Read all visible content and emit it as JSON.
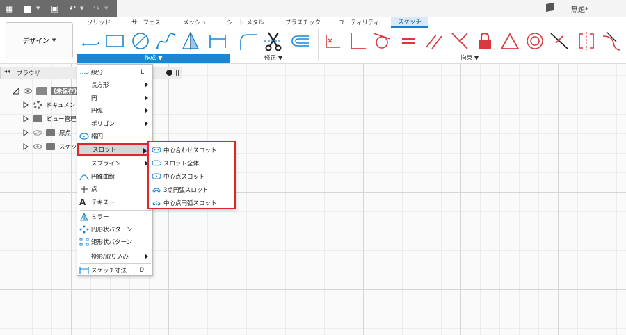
{
  "window": {
    "title": "無題*"
  },
  "tabs": [
    "ソリッド",
    "サーフェス",
    "メッシュ",
    "シート メタル",
    "プラスチック",
    "ユーティリティ",
    "スケッチ"
  ],
  "workspace": {
    "label": "デザイン"
  },
  "groups": {
    "create": "作成",
    "modify": "修正",
    "constraints": "拘束"
  },
  "browser": {
    "title": "ブラウザ",
    "root": "(未保存)",
    "items": [
      "ドキュメント",
      "ビュー管理",
      "原点",
      "スケッチ"
    ]
  },
  "create_menu": {
    "items": [
      {
        "label": "線分",
        "key": "L",
        "icon": "line-icon"
      },
      {
        "label": "長方形",
        "submenu": true
      },
      {
        "label": "円",
        "submenu": true
      },
      {
        "label": "円弧",
        "submenu": true
      },
      {
        "label": "ポリゴン",
        "submenu": true
      },
      {
        "label": "楕円",
        "icon": "ellipse-icon"
      },
      {
        "label": "スロット",
        "submenu": true,
        "highlighted": true
      },
      {
        "label": "スプライン",
        "submenu": true
      },
      {
        "label": "円錐曲線",
        "icon": "conic-icon"
      },
      {
        "label": "点",
        "icon": "point-icon"
      },
      {
        "label": "テキスト",
        "icon": "text-icon"
      },
      {
        "label": "ミラー",
        "icon": "mirror-icon"
      },
      {
        "label": "円形状パターン",
        "icon": "circular-pattern-icon"
      },
      {
        "label": "矩形状パターン",
        "icon": "rectangular-pattern-icon"
      },
      {
        "label": "投影/取り込み",
        "submenu": true
      },
      {
        "label": "スケッチ寸法",
        "key": "D",
        "icon": "dimension-icon"
      }
    ]
  },
  "slot_submenu": {
    "items": [
      {
        "label": "中心合わせスロット"
      },
      {
        "label": "スロット全体"
      },
      {
        "label": "中心点スロット"
      },
      {
        "label": "3点円弧スロット"
      },
      {
        "label": "中心点円弧スロット"
      }
    ]
  },
  "colors": {
    "accent": "#1a86d4",
    "highlight_border": "#e0262a",
    "constraint_red": "#d9393e"
  }
}
